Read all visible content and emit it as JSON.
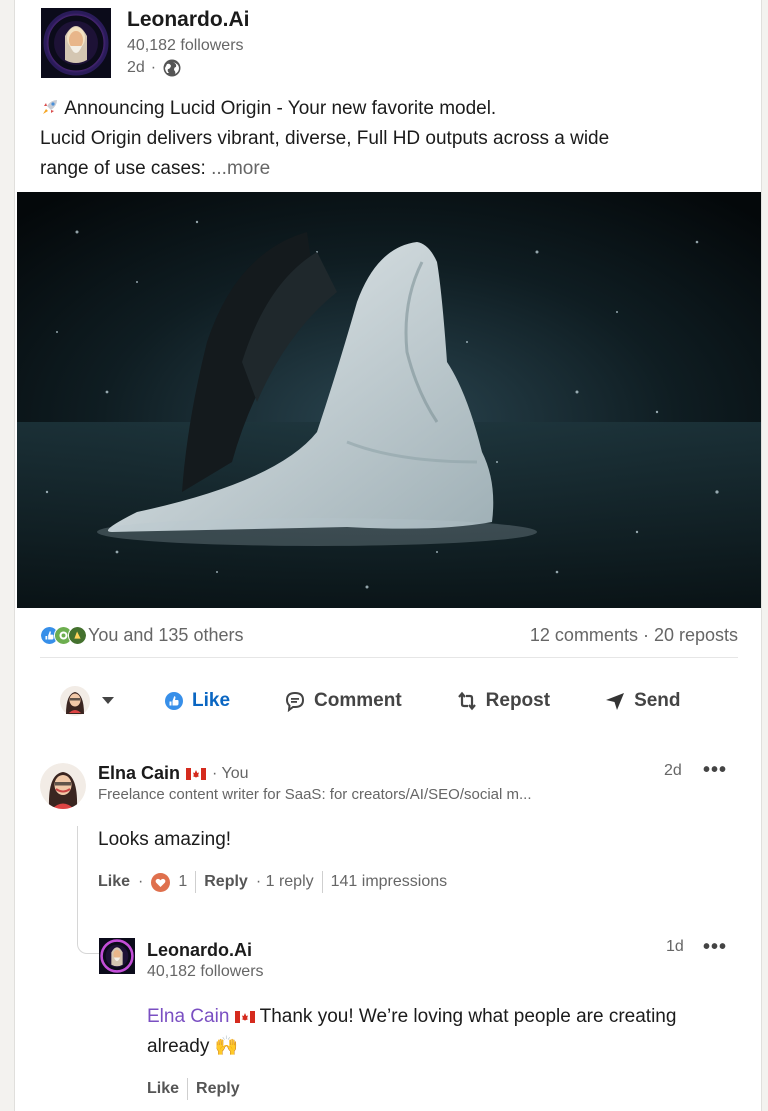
{
  "post": {
    "author": "Leonardo.Ai",
    "followers": "40,182 followers",
    "age": "2d",
    "meta_sep": "·",
    "line1": "Announcing Lucid Origin - Your new favorite model.",
    "line2": "Lucid Origin delivers vibrant, diverse, Full HD outputs across a wide",
    "line3": "range of use cases:",
    "more": "...more"
  },
  "social": {
    "reactions_text": "You and 135 others",
    "counts_text": "12 comments · 20 reposts"
  },
  "actions": {
    "like": "Like",
    "comment": "Comment",
    "repost": "Repost",
    "send": "Send"
  },
  "comment1": {
    "name": "Elna Cain",
    "you": "· You",
    "headline": "Freelance content writer for SaaS: for creators/AI/SEO/social m...",
    "time": "2d",
    "body": "Looks amazing!",
    "like": "Like",
    "like_sep": "·",
    "reaction_count": "1",
    "reply": "Reply",
    "replies": "· 1 reply",
    "impressions": "141 impressions"
  },
  "comment2": {
    "name": "Leonardo.Ai",
    "followers": "40,182 followers",
    "time": "1d",
    "mention": "Elna Cain",
    "body_rest": "Thank you! We’re loving what people are creating",
    "body_line2": "already 🙌",
    "like": "Like",
    "reply": "Reply"
  },
  "colors": {
    "accent": "#0a66c2",
    "mention": "#7a4fc2",
    "reaction_like": "#378fe9",
    "reaction_support": "#6dae4f",
    "reaction_love": "#df704d"
  }
}
